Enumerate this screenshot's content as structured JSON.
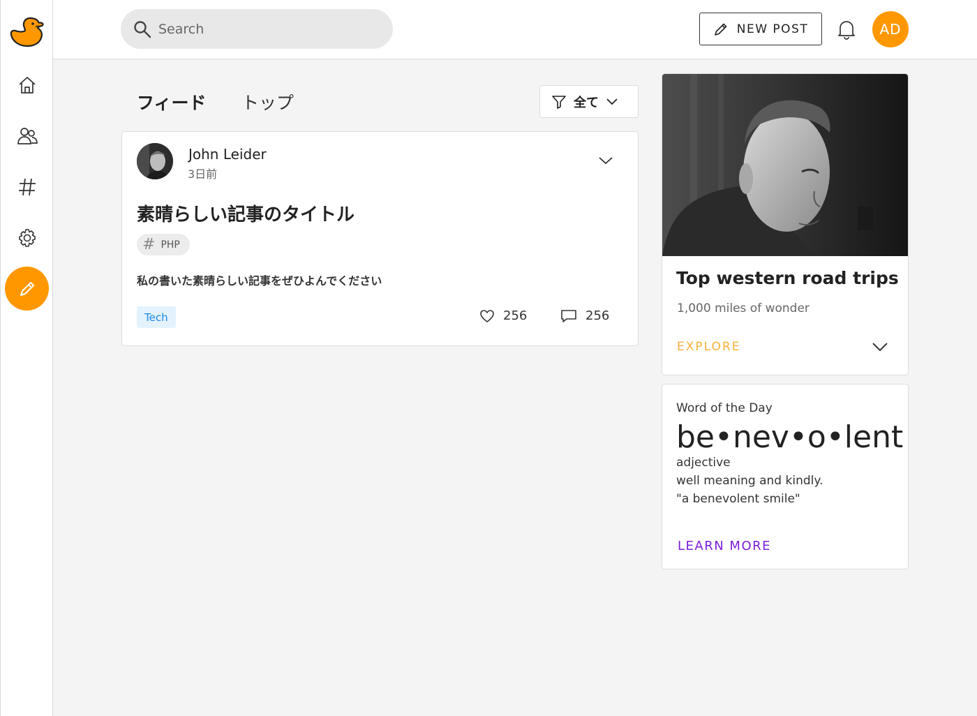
{
  "colors": {
    "accent": "#ff9800",
    "explore": "#f6b13b",
    "learn_more": "#7b1fd9",
    "tag_bg": "#e3f2fd",
    "tag_text": "#1e88e5"
  },
  "sidebar": {
    "logo": "duck-logo-icon",
    "items": [
      {
        "icon": "home-icon"
      },
      {
        "icon": "people-icon"
      },
      {
        "icon": "hashtag-icon"
      },
      {
        "icon": "gear-icon"
      },
      {
        "icon": "pencil-icon"
      }
    ]
  },
  "header": {
    "search_placeholder": "Search",
    "new_post_label": "NEW POST",
    "avatar_initials": "AD"
  },
  "feed": {
    "tabs": [
      {
        "label": "フィード",
        "active": true
      },
      {
        "label": "トップ",
        "active": false
      }
    ],
    "filter_label": "全て"
  },
  "post": {
    "author": "John Leider",
    "time": "3日前",
    "title": "素晴らしい記事のタイトル",
    "tag": "PHP",
    "body": "私の書いた素晴らしい記事をぜひよんでください",
    "category": "Tech",
    "likes": "256",
    "comments": "256"
  },
  "trip_card": {
    "title": "Top western road trips",
    "subtitle": "1,000 miles of wonder",
    "action": "EXPLORE"
  },
  "word_card": {
    "overline": "Word of the Day",
    "word": "be•nev•o•lent",
    "part_of_speech": "adjective",
    "definition": "well meaning and kindly.",
    "example": "\"a benevolent smile\"",
    "action": "LEARN MORE"
  }
}
